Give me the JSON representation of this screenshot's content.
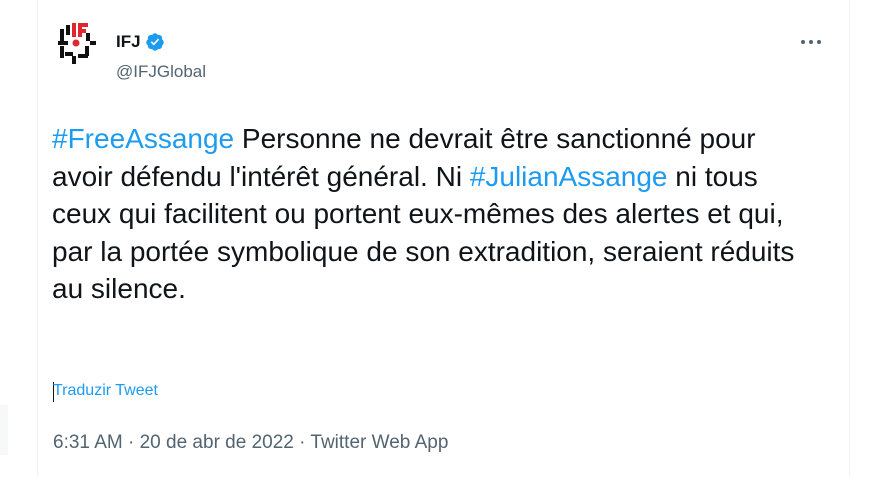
{
  "author": {
    "display_name": "IFJ",
    "handle": "@IFJGlobal",
    "verified": true,
    "verified_color": "#1d9bf0"
  },
  "tweet": {
    "hashtag_1": "#FreeAssange",
    "text_1": " Personne ne devrait être sanctionné pour avoir défendu l'intérêt général. Ni ",
    "hashtag_2": "#JulianAssange",
    "text_2": " ni tous ceux qui facilitent ou portent eux-mêmes des alertes et qui, par la portée symbolique de son extradition, seraient réduits au silence.",
    "hashtag_color": "#1d9bf0"
  },
  "translate_label": "Traduzir Tweet",
  "meta": {
    "time": "6:31 AM",
    "separator": " · ",
    "date": "20 de abr de 2022",
    "source": "Twitter Web App"
  },
  "icons": {
    "more": "more-options-icon",
    "verified": "verified-badge-icon",
    "avatar": "ifj-logo"
  }
}
